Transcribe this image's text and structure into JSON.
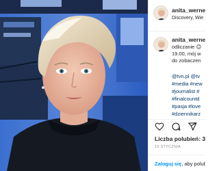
{
  "post": {
    "username": "anita_werner",
    "location": "Discovery, Wie",
    "photo_alt": "Selfie of a blonde woman in a TV studio"
  },
  "caption": {
    "username": "anita_werner",
    "line1": "odliczanie",
    "line2": "19.00, mój w",
    "line3": "do zobaczen",
    "line4": "@tvn.pl @tv",
    "tags": [
      "#media #new",
      "#journalist #",
      "#finalcountd",
      "#pasja #love",
      "#dziennikarz"
    ]
  },
  "actions": {
    "like_icon": "heart-icon",
    "comment_icon": "comment-icon",
    "share_icon": "share-icon"
  },
  "likes_text": "Liczba polubień: 3 1",
  "date_text": "10 STYCZNIA",
  "login": {
    "link": "Zaloguj się",
    "rest": ", aby polubi"
  },
  "colors": {
    "link": "#0095f6",
    "hashtag": "#00376b",
    "text": "#262626",
    "muted": "#8e8e8e",
    "studio_blue": "#1d5fc4"
  }
}
